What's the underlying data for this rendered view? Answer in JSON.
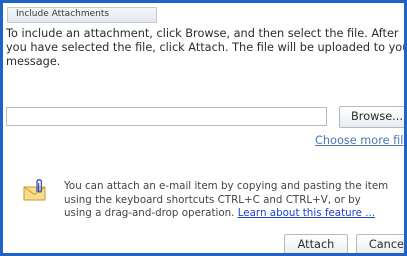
{
  "dialog": {
    "group_title": "Include Attachments",
    "intro_lines": [
      "To include an attachment, click Browse, and then select the file. After",
      "you have selected the file, click Attach. The file will be uploaded to your",
      "message."
    ],
    "file_input_value": "",
    "browse_label": "Browse...",
    "choose_more_label": "Choose more fil",
    "tip_lines": [
      "You can attach an e-mail item by copying and pasting the item",
      "using the keyboard shortcuts CTRL+C and CTRL+V, or by",
      "using a drag-and-drop operation."
    ],
    "learn_link": "Learn about this feature ...",
    "attach_label": "Attach",
    "cancel_label": "Cancel",
    "icon": "envelope-paperclip-icon",
    "colors": {
      "frame_border": "#1f63c6",
      "link": "#1f3fd0"
    }
  }
}
